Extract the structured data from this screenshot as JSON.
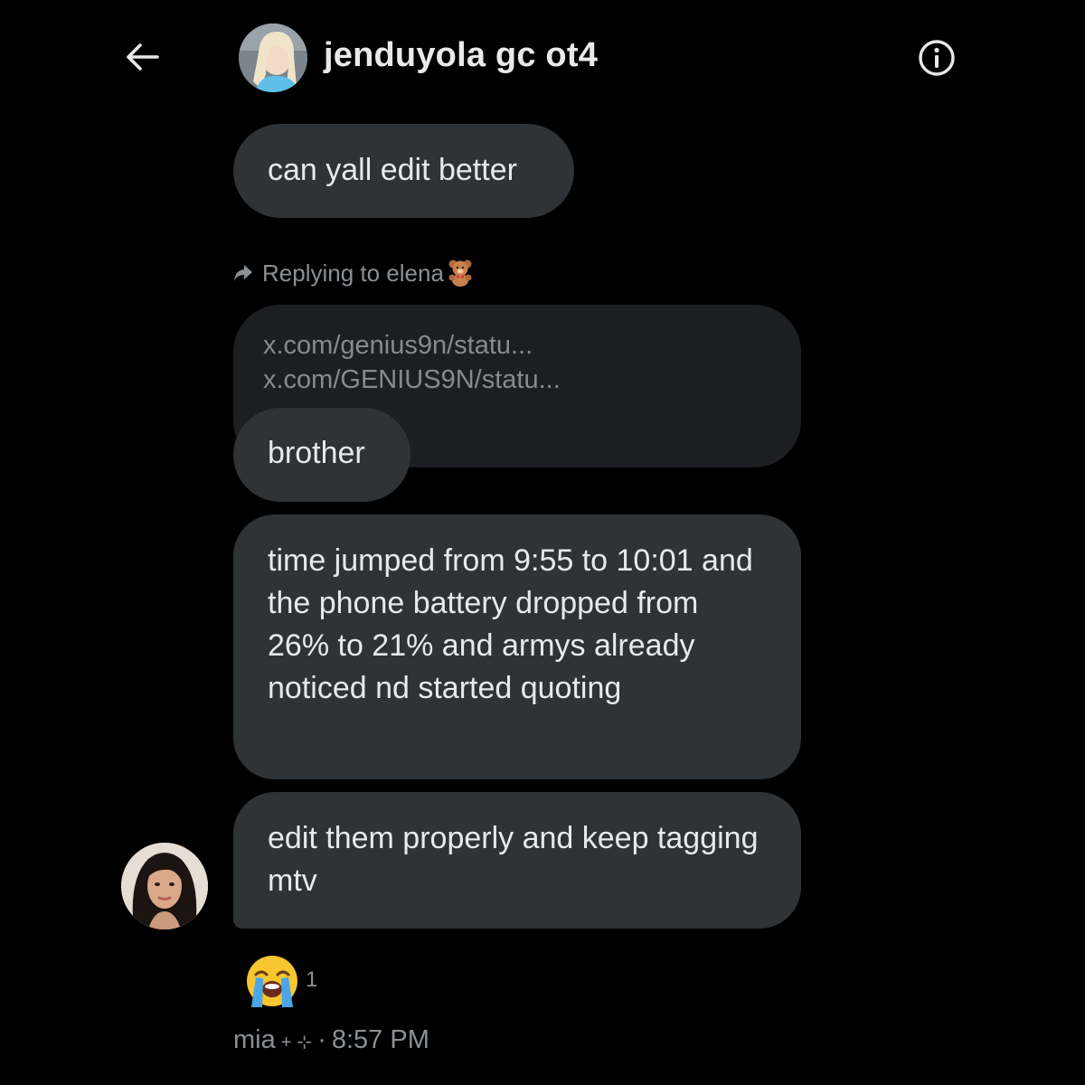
{
  "header": {
    "title": "jenduyola gc ot4",
    "back_icon": "arrow-left-icon",
    "info_icon": "info-circle-icon",
    "avatar": "group-avatar"
  },
  "messages": {
    "msg1": "can yall edit better",
    "reply_prefix": "Replying to elena",
    "reply_emoji": "teddy-bear-emoji",
    "quoted_lines": [
      "x.com/genius9n/statu...",
      "x.com/GENIUS9N/statu..."
    ],
    "msg2": "brother",
    "msg3": "time jumped from 9:55 to 10:01 and the phone battery dropped from 26% to 21% and armys already noticed nd started quoting",
    "msg4": "edit them properly and keep tagging mtv"
  },
  "reaction": {
    "emoji": "loudly-crying-face-emoji",
    "count": "1"
  },
  "meta": {
    "sender": "mia",
    "plus": "+",
    "sparkle": "⊹",
    "separator": "·",
    "time": "8:57 PM"
  },
  "colors": {
    "background": "#000000",
    "bubble": "#2f3336",
    "quoted_bubble": "#1c1e21",
    "text": "#e7e9ea",
    "muted": "#8b9095"
  }
}
